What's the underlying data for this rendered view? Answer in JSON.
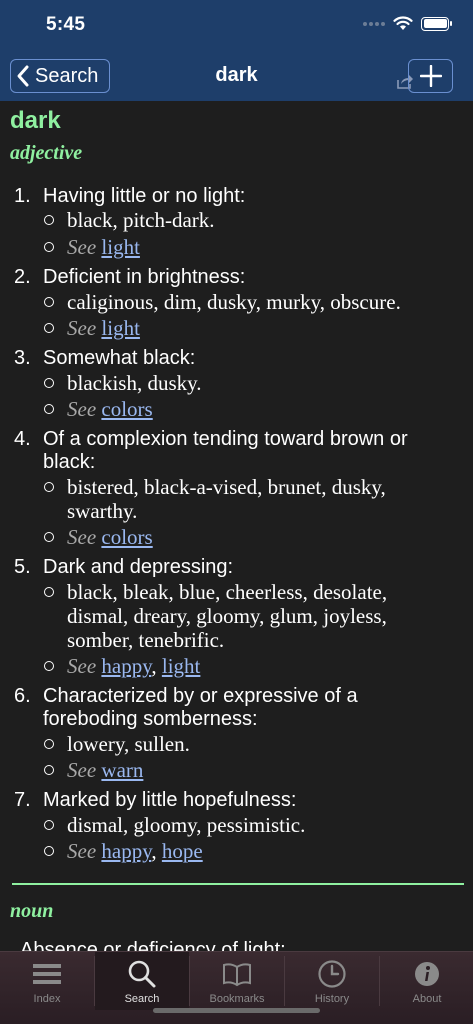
{
  "status": {
    "time": "5:45"
  },
  "nav": {
    "back_label": "Search",
    "title": "dark"
  },
  "entry": {
    "headword": "dark",
    "adjective_label": "adjective",
    "noun_label": "noun",
    "see_word": "See",
    "senses": [
      {
        "num": "1.",
        "def": "Having little or no light:",
        "synonyms": "black, pitch-dark.",
        "links": [
          "light"
        ]
      },
      {
        "num": "2.",
        "def": "Deficient in brightness:",
        "synonyms": "caliginous, dim, dusky, murky, obscure.",
        "links": [
          "light"
        ]
      },
      {
        "num": "3.",
        "def": "Somewhat black:",
        "synonyms": "blackish, dusky.",
        "links": [
          "colors"
        ]
      },
      {
        "num": "4.",
        "def": "Of a complexion tending toward brown or black:",
        "synonyms": "bistered, black-a-vised, brunet, dusky, swarthy.",
        "links": [
          "colors"
        ]
      },
      {
        "num": "5.",
        "def": "Dark and depressing:",
        "synonyms": "black, bleak, blue, cheerless, desolate, dismal, dreary, gloomy, glum, joyless, somber, tenebrific.",
        "links": [
          "happy",
          "light"
        ]
      },
      {
        "num": "6.",
        "def": "Characterized by or expressive of a foreboding somberness:",
        "synonyms": "lowery, sullen.",
        "links": [
          "warn"
        ]
      },
      {
        "num": "7.",
        "def": "Marked by little hopefulness:",
        "synonyms": "dismal, gloomy, pessimistic.",
        "links": [
          "happy",
          "hope"
        ]
      }
    ],
    "noun_partial_text": "Absence or deficiency of light:"
  },
  "tabs": [
    {
      "label": "Index",
      "icon": "list-icon"
    },
    {
      "label": "Search",
      "icon": "magnifier-icon"
    },
    {
      "label": "Bookmarks",
      "icon": "book-icon"
    },
    {
      "label": "History",
      "icon": "clock-icon"
    },
    {
      "label": "About",
      "icon": "info-icon"
    }
  ],
  "colors": {
    "nav_bg": "#1e3e6a",
    "accent_green": "#8ff0a0",
    "link": "#9ab8f0",
    "content_bg": "#1e1e1e"
  }
}
